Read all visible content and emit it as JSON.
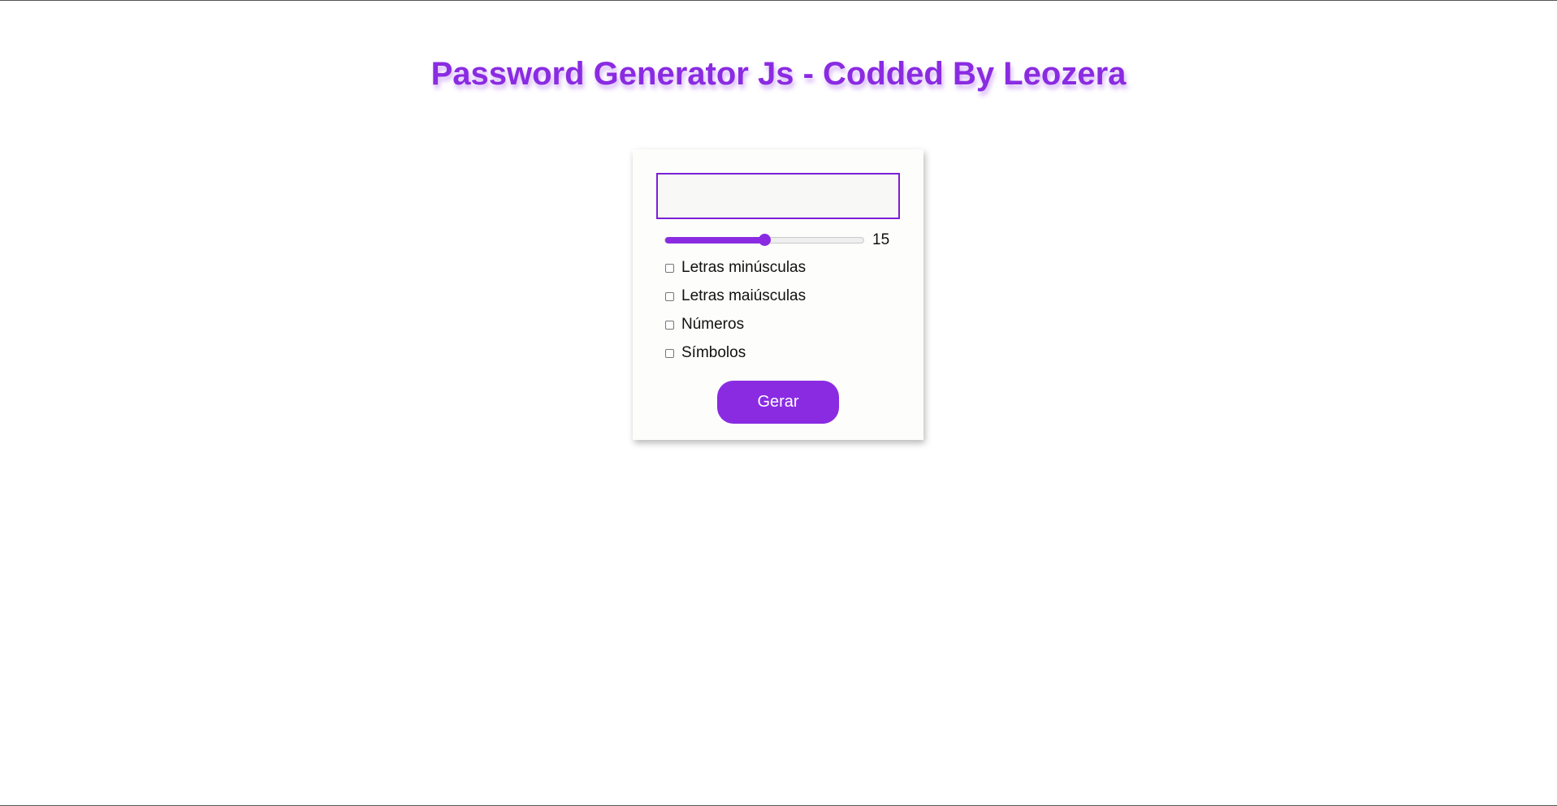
{
  "header": {
    "title": "Password Generator Js - Codded By Leozera"
  },
  "generator": {
    "password_value": "",
    "length": {
      "value": "15",
      "fraction": 0.5
    },
    "options": [
      {
        "label": "Letras minúsculas",
        "checked": false
      },
      {
        "label": "Letras maiúsculas",
        "checked": false
      },
      {
        "label": "Números",
        "checked": false
      },
      {
        "label": "Símbolos",
        "checked": false
      }
    ],
    "generate_label": "Gerar"
  },
  "colors": {
    "accent": "#8a2be2",
    "card_background": "#fdfdfb",
    "page_background": "#ffffff"
  }
}
